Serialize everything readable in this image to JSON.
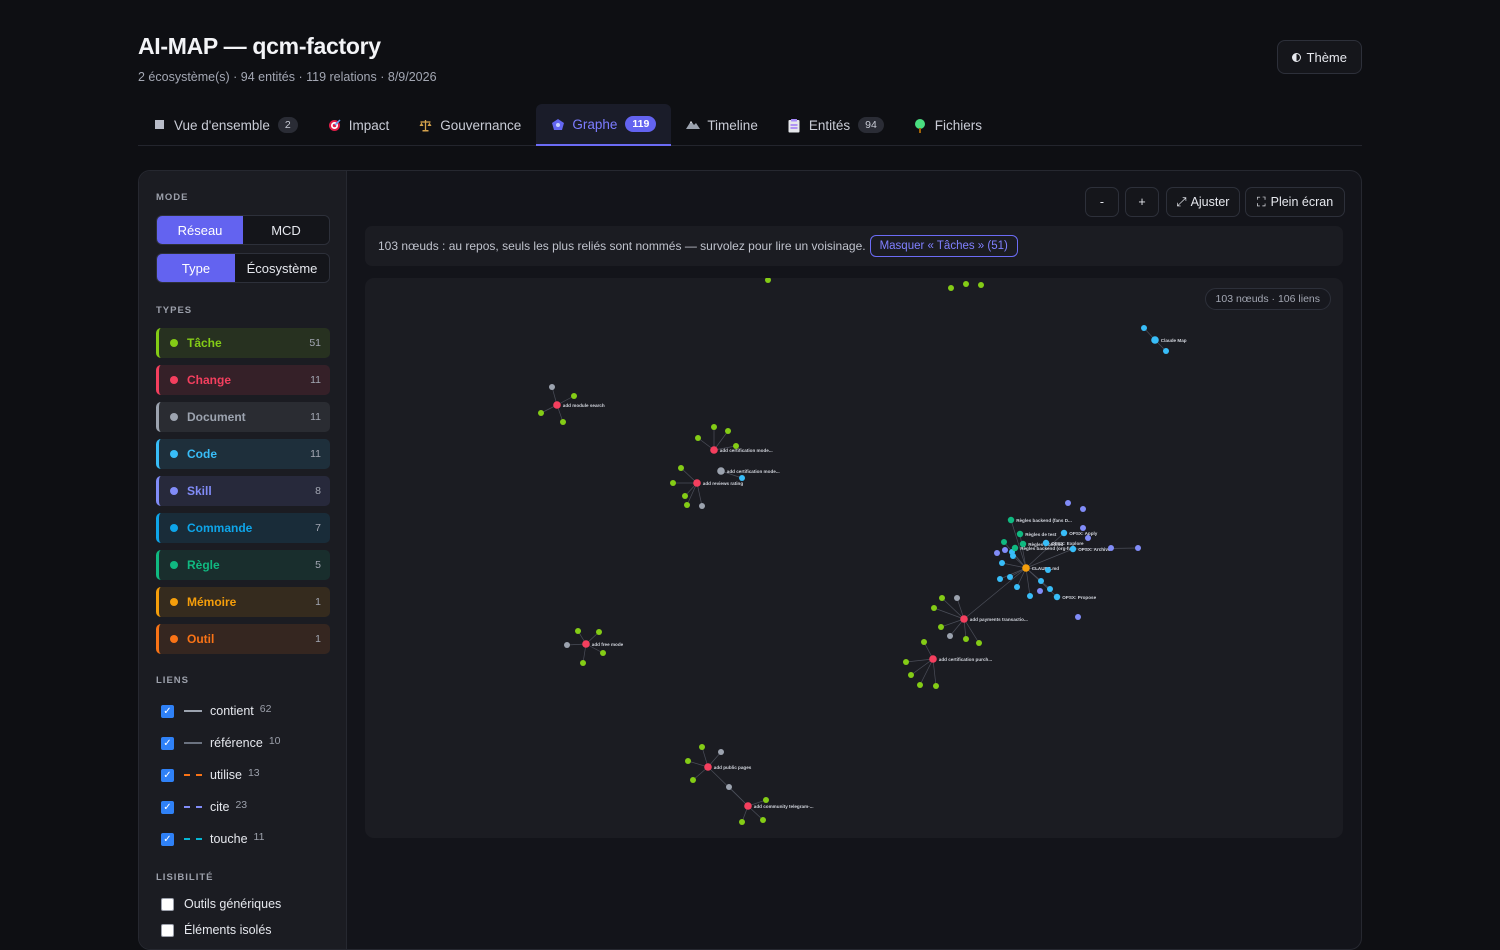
{
  "header": {
    "title": "AI-MAP — qcm-factory",
    "subtitle": "2 écosystème(s) · 94 entités · 119 relations · 8/9/2026",
    "theme_label": "Thème"
  },
  "tabs": [
    {
      "label": "Vue d'ensemble",
      "count": "2",
      "icon": "square-icon"
    },
    {
      "label": "Impact",
      "count": "",
      "icon": "target-icon"
    },
    {
      "label": "Gouvernance",
      "count": "",
      "icon": "scales-icon"
    },
    {
      "label": "Graphe",
      "count": "119",
      "icon": "network-icon",
      "active": true
    },
    {
      "label": "Timeline",
      "count": "",
      "icon": "mountain-icon"
    },
    {
      "label": "Entités",
      "count": "94",
      "icon": "list-icon"
    },
    {
      "label": "Fichiers",
      "count": "",
      "icon": "tree-icon"
    }
  ],
  "sidebar": {
    "mode_label": "MODE",
    "mode_options": [
      "Réseau",
      "MCD"
    ],
    "group_options": [
      "Type",
      "Écosystème"
    ],
    "types_label": "TYPES",
    "types": [
      {
        "label": "Tâche",
        "count": "51",
        "color": "#84cc16"
      },
      {
        "label": "Change",
        "count": "11",
        "color": "#f43f5e"
      },
      {
        "label": "Document",
        "count": "11",
        "color": "#9ca3af"
      },
      {
        "label": "Code",
        "count": "11",
        "color": "#38bdf8"
      },
      {
        "label": "Skill",
        "count": "8",
        "color": "#818cf8"
      },
      {
        "label": "Commande",
        "count": "7",
        "color": "#0ea5e9"
      },
      {
        "label": "Règle",
        "count": "5",
        "color": "#10b981"
      },
      {
        "label": "Mémoire",
        "count": "1",
        "color": "#f59e0b"
      },
      {
        "label": "Outil",
        "count": "1",
        "color": "#f97316"
      }
    ],
    "links_label": "LIENS",
    "links": [
      {
        "label": "contient",
        "count": "62",
        "color": "#9ca3af",
        "style": "solid"
      },
      {
        "label": "référence",
        "count": "10",
        "color": "#6b7280",
        "style": "solid"
      },
      {
        "label": "utilise",
        "count": "13",
        "color": "#f97316",
        "style": "dashed"
      },
      {
        "label": "cite",
        "count": "23",
        "color": "#818cf8",
        "style": "dashed"
      },
      {
        "label": "touche",
        "count": "11",
        "color": "#06b6d4",
        "style": "dashed"
      }
    ],
    "readability_label": "LISIBILITÉ",
    "readability": [
      {
        "label": "Outils génériques"
      },
      {
        "label": "Éléments isolés"
      }
    ]
  },
  "toolbar": {
    "zoom_out": "-",
    "zoom_in": "+",
    "fit": "Ajuster",
    "fullscreen": "Plein écran"
  },
  "hint": {
    "text": "103 nœuds : au repos, seuls les plus reliés sont nommés — survolez pour lire un voisinage.",
    "mask_button": "Masquer « Tâches » (51)"
  },
  "graph": {
    "stats": "103 nœuds · 106 liens",
    "labels": {
      "claude_map": "Claude Map",
      "add_module_search": "add module search",
      "add_certification_mode": "add certification mode...",
      "add_certification_mode_doc": "add certification mode...",
      "add_reviews_rating": "add reviews rating",
      "add_free_mode": "add free mode",
      "add_payments_transactions": "add payments transactio...",
      "add_certification_purchase": "add certification purch...",
      "add_public_pages": "add public pages",
      "add_community_telegram": "add community telegram-...",
      "claude_md": "CLAUDE.md",
      "regles_backend": "Règles backend (fans D...",
      "regles_test": "Règles de test",
      "regles_frontend": "Règles frontend",
      "regles_backend_2": "Règles backend (org-fu...",
      "opsx_apply": "OPSX: Apply",
      "opsx_archive": "OPSX: Archive",
      "opsx_explore": "OPSX: Explore",
      "opsx_propose": "OPSX: Propose"
    }
  }
}
